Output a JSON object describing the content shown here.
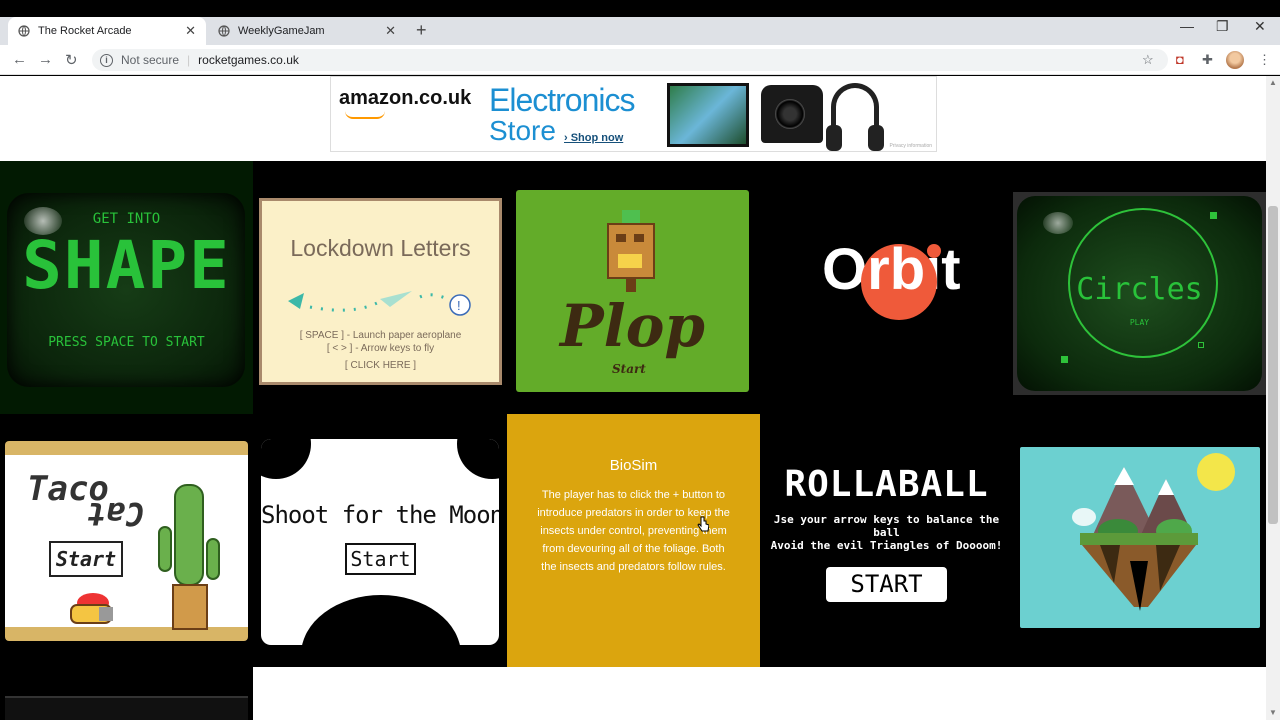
{
  "browser": {
    "tabs": [
      {
        "title": "The Rocket Arcade",
        "active": true
      },
      {
        "title": "WeeklyGameJam",
        "active": false
      }
    ],
    "address": {
      "security": "Not secure",
      "url": "rocketgames.co.uk"
    }
  },
  "ad": {
    "brand": "amazon.co.uk",
    "headline1": "Electronics",
    "headline2": "Store",
    "cta": "› Shop now",
    "privacy": "Privacy information"
  },
  "games": {
    "shape": {
      "line1": "GET INTO",
      "line2": "SHAPE",
      "line3": "PRESS SPACE TO START"
    },
    "lockdown": {
      "title": "Lockdown Letters",
      "l1": "[ SPACE ] - Launch paper aeroplane",
      "l2": "[ < > ] - Arrow keys to fly",
      "l3": "[ CLICK HERE ]"
    },
    "plop": {
      "title": "Plop",
      "start": "Start"
    },
    "orbit": {
      "pre": "O",
      "rb": "rb",
      "post": "it"
    },
    "circles": {
      "title": "Circles",
      "play": "PLAY"
    },
    "taco": {
      "w1": "Taco",
      "w2": "Cat",
      "start": "Start"
    },
    "moon": {
      "title": "Shoot for the Moon",
      "start": "Start"
    },
    "biosim": {
      "title": "BioSim",
      "desc": "The player has to click the + button to introduce predators in order to keep the insects under control, preventing them from devouring all of the foliage. Both the insects and predators follow rules."
    },
    "rollaball": {
      "title": "ROLLABALL",
      "l1": "Jse your arrow keys to balance the ball",
      "l2": "Avoid the evil Triangles of Doooom!",
      "start": "START"
    }
  },
  "colors": {
    "bg": "#000000",
    "biosim": "#dba50e",
    "plop": "#63ac29",
    "mount_sky": "#6cd0d0",
    "orbit_red": "#ef5a3a",
    "crt_green": "#29c23a"
  }
}
